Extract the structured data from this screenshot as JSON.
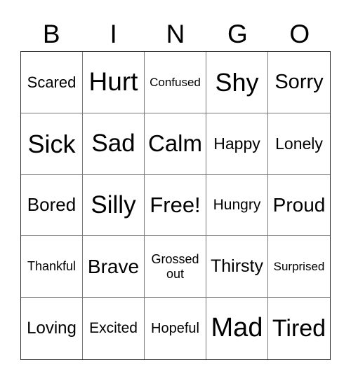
{
  "title_letters": [
    "B",
    "I",
    "N",
    "G",
    "O"
  ],
  "cells": [
    {
      "text": "Scared",
      "size": "sm"
    },
    {
      "text": "Hurt",
      "size": "xl"
    },
    {
      "text": "Confused",
      "size": "xs"
    },
    {
      "text": "Shy",
      "size": "xl"
    },
    {
      "text": "Sorry",
      "size": "lg"
    },
    {
      "text": "Sick",
      "size": "xl"
    },
    {
      "text": "Sad",
      "size": "xl"
    },
    {
      "text": "Calm",
      "size": "xl"
    },
    {
      "text": "Happy",
      "size": "md"
    },
    {
      "text": "Lonely",
      "size": "md"
    },
    {
      "text": "Bored",
      "size": "md"
    },
    {
      "text": "Silly",
      "size": "xl"
    },
    {
      "text": "Free!",
      "size": "lg"
    },
    {
      "text": "Hungry",
      "size": "sm"
    },
    {
      "text": "Proud",
      "size": "lg"
    },
    {
      "text": "Thankful",
      "size": "xs"
    },
    {
      "text": "Brave",
      "size": "lg"
    },
    {
      "text": "Grossed out",
      "size": "xs"
    },
    {
      "text": "Thirsty",
      "size": "md"
    },
    {
      "text": "Surprised",
      "size": "xs"
    },
    {
      "text": "Loving",
      "size": "md"
    },
    {
      "text": "Excited",
      "size": "sm"
    },
    {
      "text": "Hopeful",
      "size": "sm"
    },
    {
      "text": "Mad",
      "size": "xl"
    },
    {
      "text": "Tired",
      "size": "xl"
    }
  ]
}
